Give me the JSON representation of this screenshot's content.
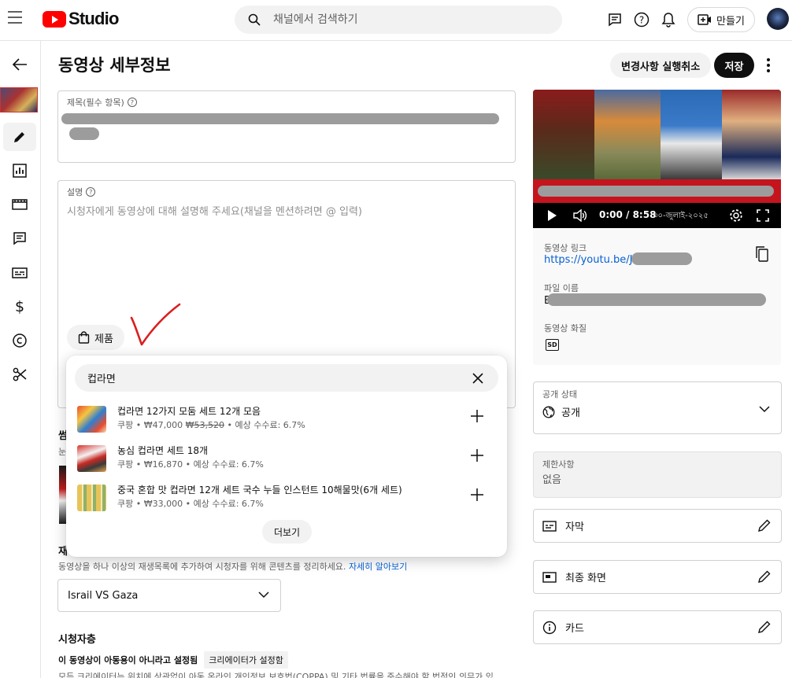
{
  "header": {
    "logo_text": "Studio",
    "search_placeholder": "채널에서 검색하기",
    "create_label": "만들기"
  },
  "page": {
    "title": "동영상 세부정보",
    "undo_label": "변경사항 실행취소",
    "save_label": "저장"
  },
  "title_field": {
    "label": "제목(필수 항목)"
  },
  "description_field": {
    "label": "설명",
    "placeholder": "시청자에게 동영상에 대해 설명해 주세요(채널을 멘션하려면 @ 입력)",
    "product_chip_label": "제품"
  },
  "product_search": {
    "query": "컵라면",
    "products": [
      {
        "name": "컵라면 12가지 모둠 세트 12개 모음",
        "seller": "쿠팡",
        "price": "₩47,000",
        "original_price": "₩53,520",
        "commission": "예상 수수료: 6.7%"
      },
      {
        "name": "농심 컵라면 세트 18개",
        "seller": "쿠팡",
        "price": "₩16,870",
        "original_price": "",
        "commission": "예상 수수료: 6.7%"
      },
      {
        "name": "중국 혼합 맛 컵라면 12개 세트 국수 누들 인스턴트 10해물맛(6개 세트)",
        "seller": "쿠팡",
        "price": "₩33,000",
        "original_price": "",
        "commission": "예상 수수료: 6.7%"
      }
    ],
    "more_label": "더보기"
  },
  "partial_labels": {
    "thumbnail_title_frag": "썸",
    "thumbnail_desc_frag": "눈",
    "playlist_title_frag": "재"
  },
  "playlist": {
    "description": "동영상을 하나 이상의 재생목록에 추가하여 시청자를 위해 콘텐츠를 정리하세요.",
    "learn_more": "자세히 알아보기",
    "selected": "Israil VS Gaza"
  },
  "audience": {
    "title": "시청자층",
    "status": "이 동영상이 아동용이 아니라고 설정됨",
    "badge": "크리에이터가 설정함",
    "description": "모든 크리에이터는 위치에 상관없이 아동 온라인 개인정보 보호법(COPPA) 및 기타 법률을 준수해야 할 법적인 의무가 있"
  },
  "video": {
    "time": "0:00 / 8:58",
    "banner_text": "৩০-জুলাই-২০২৫",
    "link_label": "동영상 링크",
    "link_prefix": "https://youtu.be/J",
    "file_label": "파일 이름",
    "file_prefix": "B",
    "quality_label": "동영상 화질",
    "quality_badge": "SD"
  },
  "visibility": {
    "label": "공개 상태",
    "value": "공개"
  },
  "restrictions": {
    "label": "제한사항",
    "value": "없음"
  },
  "extras": {
    "subtitles": "자막",
    "end_screen": "최종 화면",
    "cards": "카드"
  },
  "colors": {
    "brand_red": "#ff0000",
    "link_blue": "#065fd4",
    "annotation_red": "#d92020"
  }
}
